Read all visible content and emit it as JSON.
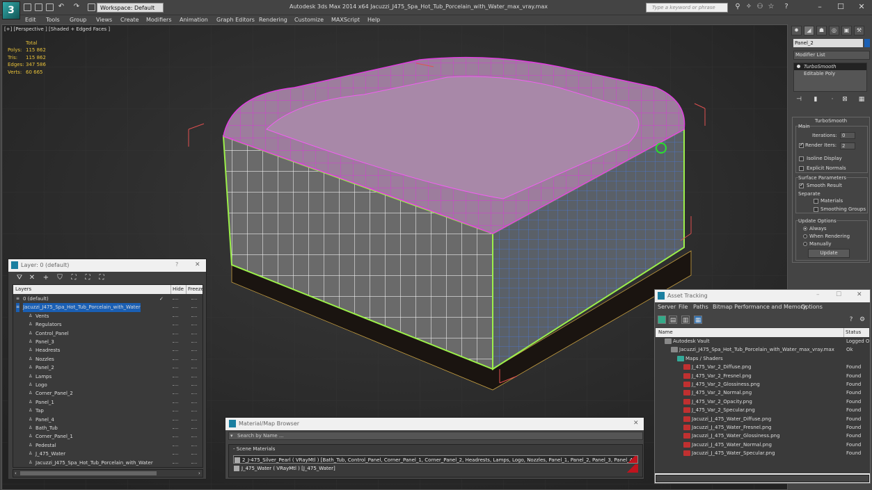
{
  "app": {
    "title": "Autodesk 3ds Max  2014 x64     Jacuzzi_J475_Spa_Hot_Tub_Porcelain_with_Water_max_vray.max",
    "workspace": "Workspace: Default",
    "search_placeholder": "Type a keyword or phrase"
  },
  "menu": [
    "Edit",
    "Tools",
    "Group",
    "Views",
    "Create",
    "Modifiers",
    "Animation",
    "Graph Editors",
    "Rendering",
    "Customize",
    "MAXScript",
    "Help"
  ],
  "viewport": {
    "label": "[+] [Perspective ] [Shaded + Edged Faces ]",
    "stats": {
      "total_label": "Total",
      "rows": [
        {
          "key": "Polys:",
          "value": "115 862"
        },
        {
          "key": "Tris:",
          "value": "115 862"
        },
        {
          "key": "Edges:",
          "value": "347 586"
        },
        {
          "key": "Verts:",
          "value": "60 665"
        }
      ]
    }
  },
  "command_panel": {
    "object_name": "Panel_2",
    "object_color": "#1a5fb4",
    "modifier_list": "Modifier List",
    "stack": [
      "TurboSmooth",
      "Editable Poly"
    ],
    "turbosmooth": {
      "title": "TurboSmooth",
      "main": "Main",
      "iterations_label": "Iterations:",
      "iterations": "0",
      "render_iters_label": "Render Iters:",
      "render_iters": "2",
      "isoline": "Isoline Display",
      "explicit": "Explicit Normals",
      "surface_params": "Surface Parameters",
      "smooth_result": "Smooth Result",
      "separate": "Separate",
      "materials": "Materials",
      "smoothing_groups": "Smoothing Groups",
      "update_options": "Update Options",
      "always": "Always",
      "when_rendering": "When Rendering",
      "manually": "Manually",
      "update": "Update"
    }
  },
  "layer_dialog": {
    "title": "Layer: 0 (default)",
    "help": "?",
    "close": "✕",
    "col_layers": "Layers",
    "col_hide": "Hide",
    "col_freeze": "Freeze",
    "rows": [
      {
        "name": "0 (default)",
        "indent": 0,
        "check": "✓"
      },
      {
        "name": "Jacuzzi_J475_Spa_Hot_Tub_Porcelain_with_Water",
        "indent": 0,
        "selected": true
      },
      {
        "name": "Vents",
        "indent": 1
      },
      {
        "name": "Regulators",
        "indent": 1
      },
      {
        "name": "Control_Panel",
        "indent": 1
      },
      {
        "name": "Panel_3",
        "indent": 1
      },
      {
        "name": "Headrests",
        "indent": 1
      },
      {
        "name": "Nozzles",
        "indent": 1
      },
      {
        "name": "Panel_2",
        "indent": 1
      },
      {
        "name": "Lamps",
        "indent": 1
      },
      {
        "name": "Logo",
        "indent": 1
      },
      {
        "name": "Corner_Panel_2",
        "indent": 1
      },
      {
        "name": "Panel_1",
        "indent": 1
      },
      {
        "name": "Tap",
        "indent": 1
      },
      {
        "name": "Panel_4",
        "indent": 1
      },
      {
        "name": "Bath_Tub",
        "indent": 1
      },
      {
        "name": "Corner_Panel_1",
        "indent": 1
      },
      {
        "name": "Pedestal",
        "indent": 1
      },
      {
        "name": "J_475_Water",
        "indent": 1
      },
      {
        "name": "Jacuzzi_J475_Spa_Hot_Tub_Porcelain_with_Water",
        "indent": 1
      }
    ]
  },
  "material_browser": {
    "title": "Material/Map Browser",
    "close": "✕",
    "search": "Search by Name ...",
    "group": "- Scene Materials",
    "rows": [
      "2_J-475_Silver_Pearl  ( VRayMtl ) [Bath_Tub, Control_Panel, Corner_Panel_1, Corner_Panel_2, Headrests, Lamps, Logo, Nozzles, Panel_1, Panel_2, Panel_3, Panel_4, Pe...",
      "J_475_Water  ( VRayMtl ) [J_475_Water]"
    ]
  },
  "asset_tracking": {
    "title": "Asset Tracking",
    "menu": [
      "Server",
      "File",
      "Paths",
      "Bitmap Performance and Memory",
      "Options"
    ],
    "col_name": "Name",
    "col_status": "Status",
    "rows": [
      {
        "name": "Autodesk Vault",
        "status": "Logged O",
        "indent": 1
      },
      {
        "name": "Jacuzzi_J475_Spa_Hot_Tub_Porcelain_with_Water_max_vray.max",
        "status": "Ok",
        "indent": 2
      },
      {
        "name": "Maps / Shaders",
        "status": "",
        "indent": 3
      },
      {
        "name": "J_475_Var_2_Diffuse.png",
        "status": "Found",
        "indent": 4
      },
      {
        "name": "J_475_Var_2_Fresnel.png",
        "status": "Found",
        "indent": 4
      },
      {
        "name": "J_475_Var_2_Glossiness.png",
        "status": "Found",
        "indent": 4
      },
      {
        "name": "J_475_Var_2_Normal.png",
        "status": "Found",
        "indent": 4
      },
      {
        "name": "J_475_Var_2_Opacity.png",
        "status": "Found",
        "indent": 4
      },
      {
        "name": "J_475_Var_2_Specular.png",
        "status": "Found",
        "indent": 4
      },
      {
        "name": "Jacuzzi_J_475_Water_Diffuse.png",
        "status": "Found",
        "indent": 4
      },
      {
        "name": "Jacuzzi_J_475_Water_Fresnel.png",
        "status": "Found",
        "indent": 4
      },
      {
        "name": "Jacuzzi_J_475_Water_Glossiness.png",
        "status": "Found",
        "indent": 4
      },
      {
        "name": "Jacuzzi_J_475_Water_Normal.png",
        "status": "Found",
        "indent": 4
      },
      {
        "name": "Jacuzzi_J_475_Water_Specular.png",
        "status": "Found",
        "indent": 4
      }
    ]
  }
}
